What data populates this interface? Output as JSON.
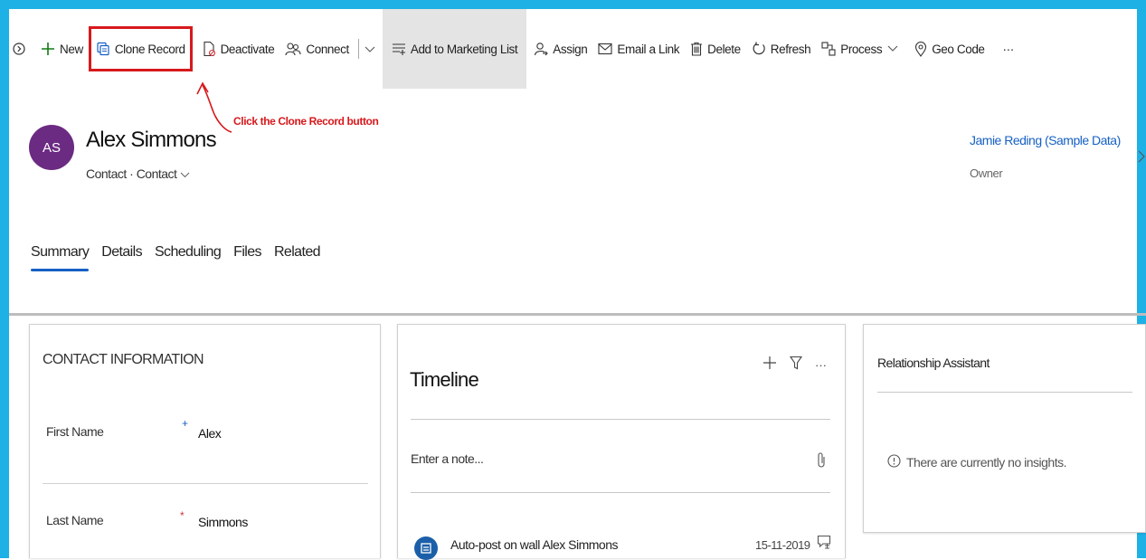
{
  "toolbar": {
    "new_label": "New",
    "clone_label": "Clone Record",
    "deactivate_label": "Deactivate",
    "connect_label": "Connect",
    "add_marketing_label": "Add to Marketing List",
    "assign_label": "Assign",
    "email_link_label": "Email a Link",
    "delete_label": "Delete",
    "refresh_label": "Refresh",
    "process_label": "Process",
    "geocode_label": "Geo Code",
    "more_label": "···"
  },
  "annotation": {
    "text": "Click the Clone Record button",
    "color": "#d7191c"
  },
  "record": {
    "initials": "AS",
    "name": "Alex Simmons",
    "type": "Contact · Contact",
    "avatar_color": "#6b2b82"
  },
  "owner": {
    "name": "Jamie Reding (Sample Data)",
    "label": "Owner"
  },
  "tabs": [
    {
      "label": "Summary"
    },
    {
      "label": "Details"
    },
    {
      "label": "Scheduling"
    },
    {
      "label": "Files"
    },
    {
      "label": "Related"
    }
  ],
  "contact_info": {
    "title": "CONTACT INFORMATION",
    "fields": [
      {
        "label": "First Name",
        "required_mark": "+",
        "value": "Alex"
      },
      {
        "label": "Last Name",
        "required_mark": "*",
        "value": "Simmons"
      }
    ]
  },
  "timeline": {
    "title": "Timeline",
    "note_placeholder": "Enter a note...",
    "post_text": "Auto-post on wall Alex Simmons",
    "post_date": "15-11-2019"
  },
  "relationship": {
    "title": "Relationship Assistant",
    "empty_text": "There are currently no insights."
  },
  "colors": {
    "accent": "#1660c4",
    "frame": "#1eb1e6",
    "highlight": "#e4e4e4"
  }
}
